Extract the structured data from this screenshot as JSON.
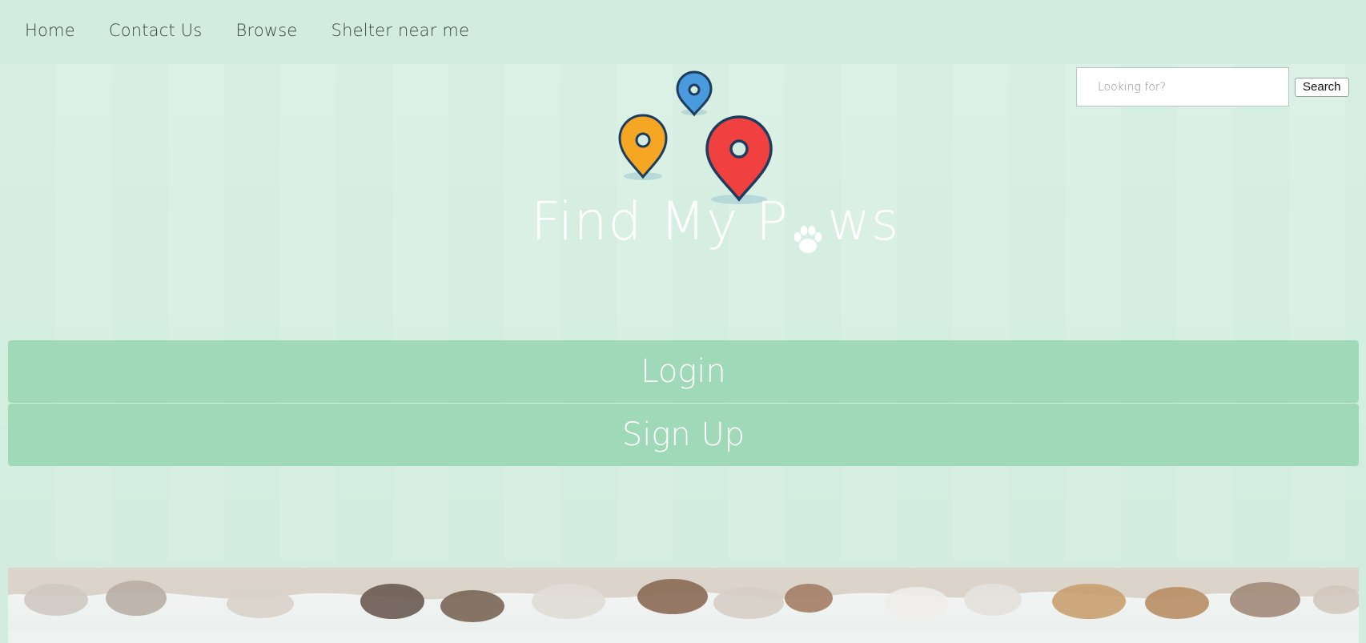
{
  "nav": {
    "items": [
      {
        "label": "Home"
      },
      {
        "label": "Contact Us"
      },
      {
        "label": "Browse"
      },
      {
        "label": "Shelter near me"
      }
    ]
  },
  "search": {
    "placeholder": "Looking for?",
    "button_label": "Search"
  },
  "brand": {
    "name_part1": "Find My P",
    "name_part2": "ws",
    "logo_icon": "map-pins-icon",
    "paw_icon": "paw-icon",
    "pin_colors": [
      "#4a9ade",
      "#f5a623",
      "#f04040"
    ]
  },
  "actions": {
    "login_label": "Login",
    "signup_label": "Sign Up"
  },
  "colors": {
    "background": "#d2eddf",
    "button": "#a0d9b8",
    "brand_text": "#ffffff"
  },
  "banner": {
    "image": "dog-paws-banner"
  }
}
